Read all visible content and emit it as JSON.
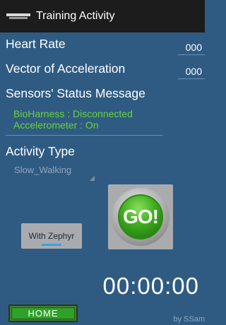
{
  "titlebar": {
    "title": "Training Activity",
    "icon": "app-logo-icon"
  },
  "heart_rate": {
    "label": "Heart Rate",
    "value": "000"
  },
  "acceleration": {
    "label": "Vector of Acceleration",
    "value": "000"
  },
  "sensors": {
    "label": "Sensors' Status Message",
    "line1": "BioHarness : Disconnected",
    "line2": "Accelerometer : On",
    "color": "#6ad33a"
  },
  "activity": {
    "label": "Activity Type",
    "selected": "Slow_Walking"
  },
  "go_button": {
    "label": "GO!",
    "color": "#3daa1e"
  },
  "zephyr_button": {
    "label": "With Zephyr",
    "indicator_color": "#3da0e2"
  },
  "timer": {
    "value": "00:00:00"
  },
  "home_button": {
    "label": "HOME"
  },
  "credit": "by SSam",
  "colors": {
    "background": "#2f5b83",
    "titlebar": "#1c1c1c",
    "accent": "#3da0e2"
  }
}
